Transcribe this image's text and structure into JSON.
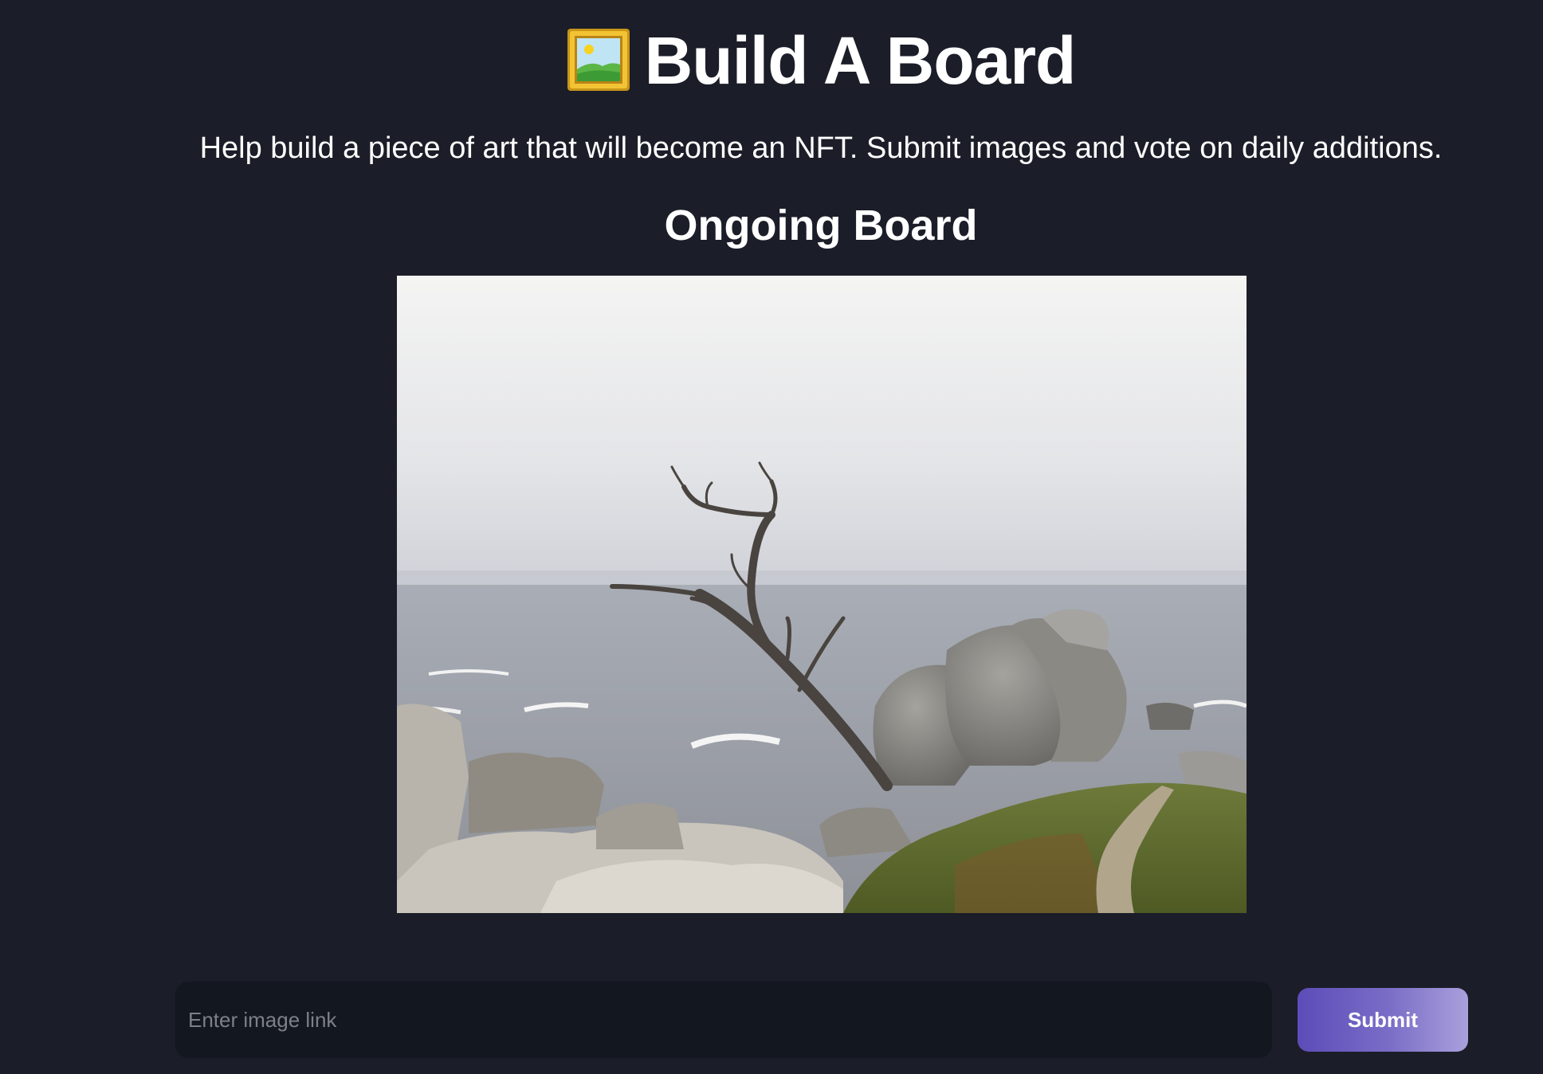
{
  "header": {
    "title": "Build A Board",
    "title_icon": "framed-picture-icon",
    "subtitle": "Help build a piece of art that will become an NFT. Submit images and vote on daily additions."
  },
  "board": {
    "heading": "Ongoing Board",
    "image_alt": "Lone cypress tree on a rocky coast"
  },
  "submit_form": {
    "input_placeholder": "Enter image link",
    "input_value": "",
    "button_label": "Submit"
  },
  "colors": {
    "background": "#1b1e28",
    "input_background": "#131720",
    "button_gradient_start": "#5b4cb8",
    "button_gradient_end": "#aaa0dc"
  }
}
